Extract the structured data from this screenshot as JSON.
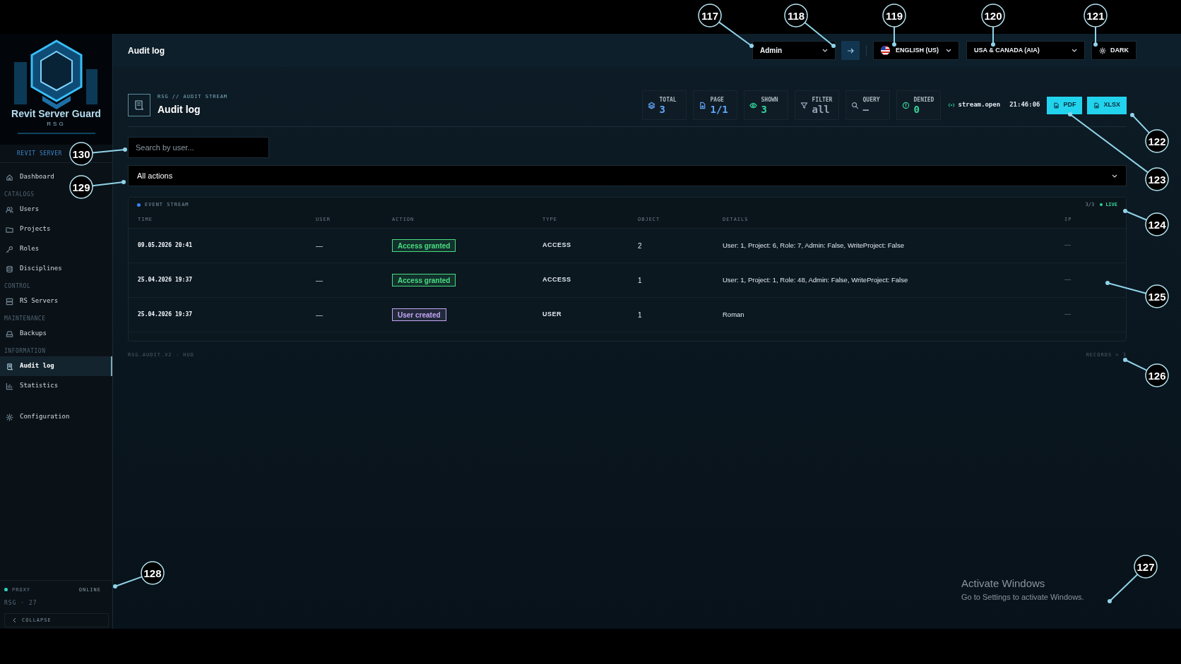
{
  "sidebar": {
    "brand_title": "Revit Server Guard",
    "brand_sub": "RSG",
    "section_label": "REVIT SERVER",
    "nav": [
      {
        "kind": "item",
        "label": "Dashboard",
        "selected": false
      },
      {
        "kind": "heading",
        "label": "CATALOGS"
      },
      {
        "kind": "item",
        "label": "Users",
        "selected": false
      },
      {
        "kind": "item",
        "label": "Projects",
        "selected": false
      },
      {
        "kind": "item",
        "label": "Roles",
        "selected": false
      },
      {
        "kind": "item",
        "label": "Disciplines",
        "selected": false
      },
      {
        "kind": "heading",
        "label": "CONTROL"
      },
      {
        "kind": "item",
        "label": "RS Servers",
        "selected": false
      },
      {
        "kind": "heading",
        "label": "MAINTENANCE"
      },
      {
        "kind": "item",
        "label": "Backups",
        "selected": false
      },
      {
        "kind": "heading",
        "label": "INFORMATION"
      },
      {
        "kind": "item",
        "label": "Audit log",
        "selected": true
      },
      {
        "kind": "item",
        "label": "Statistics",
        "selected": false
      },
      {
        "kind": "spacer"
      },
      {
        "kind": "item",
        "label": "Configuration",
        "selected": false
      }
    ],
    "proxy": {
      "label": "PROXY",
      "status": "ONLINE",
      "online": true
    },
    "version": "RSG · 27",
    "collapse": "COLLAPSE"
  },
  "header": {
    "title": "Audit log",
    "user_select": "Admin",
    "language": "ENGLISH (US)",
    "region": "USA & CANADA (AIA)",
    "theme": "DARK"
  },
  "page": {
    "eyebrow": "RSG // AUDIT STREAM",
    "title": "Audit log",
    "stats": [
      {
        "kind": "layers",
        "label": "TOTAL",
        "value": "3",
        "color": "#60a5fa"
      },
      {
        "kind": "file",
        "label": "PAGE",
        "value": "1/1",
        "color": "#60a5fa"
      },
      {
        "kind": "eye",
        "label": "SHOWN",
        "value": "3",
        "color": "#34d399"
      },
      {
        "kind": "filter",
        "label": "FILTER",
        "value": "all",
        "color": "#94a3b8"
      },
      {
        "kind": "search",
        "label": "QUERY",
        "value": "—",
        "color": "#94a3b8"
      },
      {
        "kind": "alert",
        "label": "DENIED",
        "value": "0",
        "color": "#34d399"
      }
    ],
    "stream": {
      "label": "stream.open",
      "time": "21:46:06"
    },
    "exports": [
      "PDF",
      "XLSX"
    ],
    "search": {
      "placeholder": "Search by user..."
    },
    "action_filter": "All actions"
  },
  "table": {
    "title": "EVENT STREAM",
    "count": "3/3",
    "live": "LIVE",
    "columns": [
      "TIME",
      "USER",
      "ACTION",
      "TYPE",
      "OBJECT",
      "DETAILS",
      "IP"
    ],
    "rows": [
      {
        "time": "09.05.2026 20:41",
        "user": "—",
        "action": {
          "label": "Access granted",
          "color": "#4ade80"
        },
        "type": "ACCESS",
        "object": "2",
        "details": "User: 1, Project: 6, Role: 7, Admin: False, WriteProject: False",
        "ip": "—"
      },
      {
        "time": "25.04.2026 19:37",
        "user": "—",
        "action": {
          "label": "Access granted",
          "color": "#4ade80"
        },
        "type": "ACCESS",
        "object": "1",
        "details": "User: 1, Project: 1, Role: 48, Admin: False, WriteProject: False",
        "ip": "—"
      },
      {
        "time": "25.04.2026 19:37",
        "user": "—",
        "action": {
          "label": "User created",
          "color": "#c4a5f5"
        },
        "type": "USER",
        "object": "1",
        "details": "Roman",
        "ip": "—"
      }
    ],
    "footer_left": "RSG.AUDIT.V2 - HUD",
    "footer_right": "RECORDS > 3"
  },
  "os_notice": {
    "title": "Activate Windows",
    "subtitle": "Go to Settings to activate Windows."
  },
  "callouts": [
    {
      "label": "117"
    },
    {
      "label": "118"
    },
    {
      "label": "119"
    },
    {
      "label": "120"
    },
    {
      "label": "121"
    },
    {
      "label": "122"
    },
    {
      "label": "123"
    },
    {
      "label": "124"
    },
    {
      "label": "125"
    },
    {
      "label": "126"
    },
    {
      "label": "127"
    },
    {
      "label": "128"
    },
    {
      "label": "129"
    },
    {
      "label": "130"
    }
  ]
}
